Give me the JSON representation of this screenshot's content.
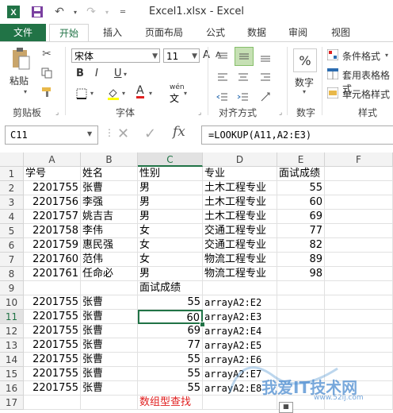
{
  "app": {
    "title": "Excel1.xlsx - Excel"
  },
  "tabs": [
    "文件",
    "开始",
    "插入",
    "页面布局",
    "公式",
    "数据",
    "审阅",
    "视图"
  ],
  "ribbon": {
    "clipboard": {
      "label": "剪贴板",
      "paste_label": "粘贴"
    },
    "font": {
      "label": "字体",
      "name": "宋体",
      "size": "11",
      "bold": "B",
      "italic": "I",
      "underline": "U",
      "grow": "A",
      "shrink": "A",
      "color_a": "A",
      "wen": "wén"
    },
    "alignment": {
      "label": "对齐方式"
    },
    "number": {
      "label": "数字",
      "percent": "%"
    },
    "styles": {
      "label": "样式",
      "cond": "条件格式",
      "table": "套用表格格式",
      "cell": "单元格样式"
    }
  },
  "formula_bar": {
    "name_box": "C11",
    "fx": "fx",
    "formula": "=LOOKUP(A11,A2:E3)"
  },
  "grid": {
    "columns": [
      "A",
      "B",
      "C",
      "D",
      "E",
      "F"
    ],
    "rows": [
      "1",
      "2",
      "3",
      "4",
      "5",
      "6",
      "7",
      "8",
      "9",
      "10",
      "11",
      "12",
      "13",
      "14",
      "15",
      "16",
      "17"
    ],
    "selected_col": "C",
    "selected_row": "11",
    "header_row": [
      "学号",
      "姓名",
      "性别",
      "专业",
      "面试成绩"
    ],
    "data": [
      [
        "2201755",
        "张曹",
        "男",
        "土木工程专业",
        "55"
      ],
      [
        "2201756",
        "李强",
        "男",
        "土木工程专业",
        "60"
      ],
      [
        "2201757",
        "姚吉吉",
        "男",
        "土木工程专业",
        "69"
      ],
      [
        "2201758",
        "李伟",
        "女",
        "交通工程专业",
        "77"
      ],
      [
        "2201759",
        "惠民强",
        "女",
        "交通工程专业",
        "82"
      ],
      [
        "2201760",
        "范伟",
        "女",
        "物流工程专业",
        "89"
      ],
      [
        "2201761",
        "任命必",
        "男",
        "物流工程专业",
        "98"
      ]
    ],
    "row9_c": "面试成绩",
    "lookup_rows": [
      [
        "2201755",
        "张曹",
        "55",
        "arrayA2:E2"
      ],
      [
        "2201755",
        "张曹",
        "60",
        "arrayA2:E3"
      ],
      [
        "2201755",
        "张曹",
        "69",
        "arrayA2:E4"
      ],
      [
        "2201755",
        "张曹",
        "77",
        "arrayA2:E5"
      ],
      [
        "2201755",
        "张曹",
        "55",
        "arrayA2:E6"
      ],
      [
        "2201755",
        "张曹",
        "55",
        "arrayA2:E7"
      ],
      [
        "2201755",
        "张曹",
        "55",
        "arrayA2:E8"
      ]
    ],
    "row17_c": "数组型查找",
    "watermark": "我爱IT技术网",
    "watermark_url": "www.52ij.com"
  }
}
